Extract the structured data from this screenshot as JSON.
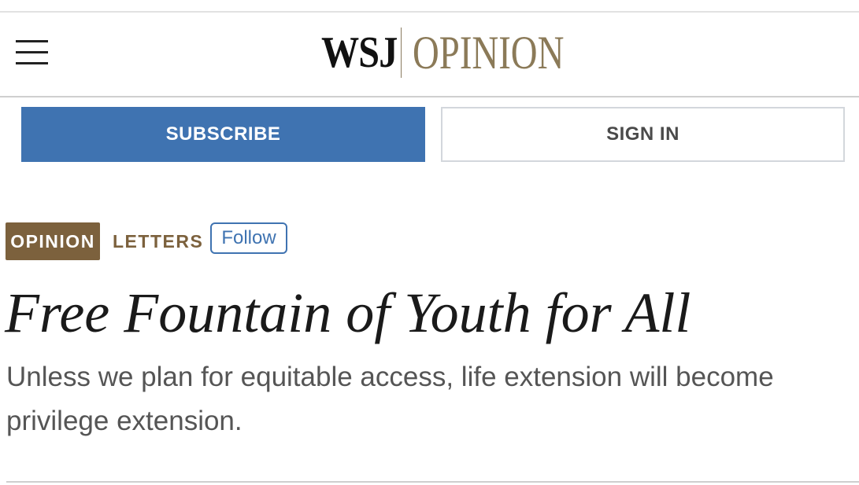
{
  "header": {
    "menu_icon": "hamburger-menu-icon",
    "logo_primary": "WSJ",
    "logo_section": "OPINION"
  },
  "auth": {
    "subscribe_label": "SUBSCRIBE",
    "signin_label": "SIGN IN"
  },
  "article": {
    "section_badge": "OPINION",
    "category": "LETTERS",
    "follow_label": "Follow",
    "headline": "Free Fountain of Youth for All",
    "dek": "Unless we plan for equitable access, life extension will become privilege extension."
  },
  "colors": {
    "subscribe_blue": "#3f73b1",
    "opinion_brown": "#7c613d",
    "logo_gold": "#8b7a58"
  }
}
